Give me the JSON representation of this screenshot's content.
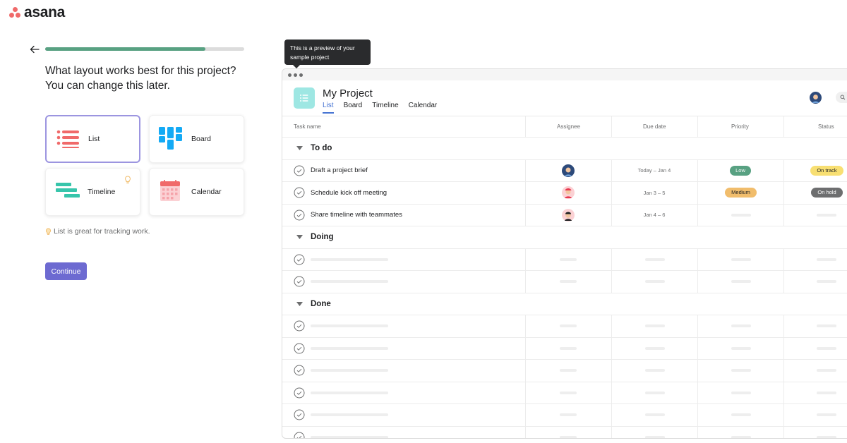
{
  "brand": {
    "name": "asana",
    "accent": "#f06a6a"
  },
  "onboarding": {
    "progress": 0.805,
    "question": "What layout works best for this project? You can change this later.",
    "layouts": [
      {
        "id": "list",
        "label": "List",
        "icon": "list-layout-icon",
        "selected": true
      },
      {
        "id": "board",
        "label": "Board",
        "icon": "board-layout-icon",
        "selected": false
      },
      {
        "id": "timeline",
        "label": "Timeline",
        "icon": "timeline-layout-icon",
        "selected": false,
        "tip_icon": "lightbulb-icon"
      },
      {
        "id": "calendar",
        "label": "Calendar",
        "icon": "calendar-layout-icon",
        "selected": false
      }
    ],
    "hint": "List is great for tracking work.",
    "continue_label": "Continue",
    "colors": {
      "continue": "#6d6ad1",
      "progress": "#58a182",
      "selected_border": "#9c95e0"
    }
  },
  "tooltip": {
    "text": "This is a preview of your sample project"
  },
  "preview": {
    "project_title": "My Project",
    "tabs": [
      "List",
      "Board",
      "Timeline",
      "Calendar"
    ],
    "active_tab": "List",
    "columns": [
      "Task name",
      "Assignee",
      "Due date",
      "Priority",
      "Status"
    ],
    "sections": [
      {
        "title": "To do",
        "tasks": [
          {
            "name": "Draft a project brief",
            "due": "Today – Jan 4",
            "priority": "Low",
            "status": "On track"
          },
          {
            "name": "Schedule kick off meeting",
            "due": "Jan 3 – 5",
            "priority": "Medium",
            "status": "On hold"
          },
          {
            "name": "Share timeline with teammates",
            "due": "Jan 4 – 6",
            "priority": "",
            "status": ""
          }
        ]
      },
      {
        "title": "Doing",
        "placeholder_rows": 2
      },
      {
        "title": "Done",
        "placeholder_rows": 6
      }
    ],
    "colors": {
      "low": "#58a182",
      "medium": "#f1bd6c",
      "on_track": "#f8df72",
      "on_hold": "#6d6e6f",
      "project_icon": "#9ee7e3"
    }
  }
}
